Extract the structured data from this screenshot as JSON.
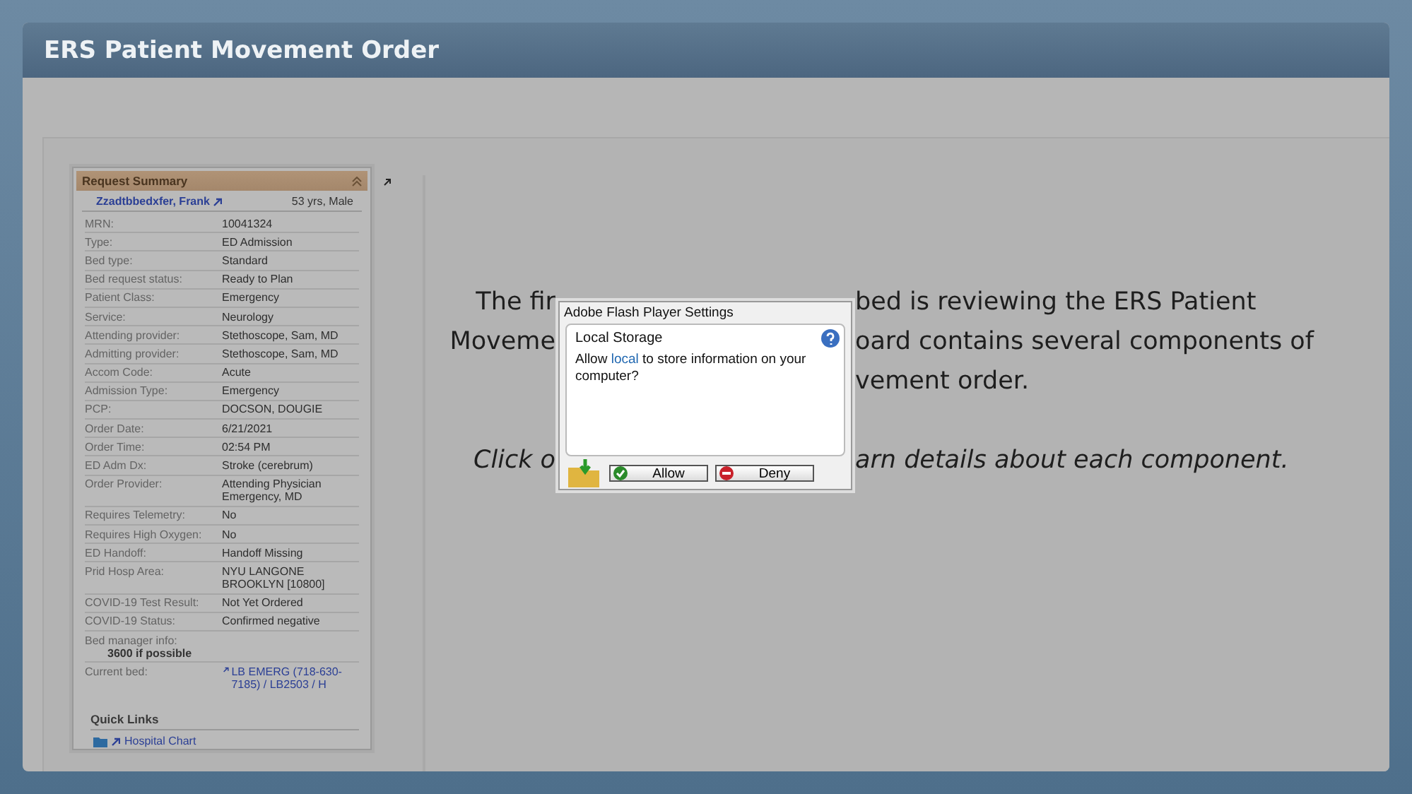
{
  "window": {
    "title": "ERS Patient Movement Order"
  },
  "summary": {
    "title": "Request Summary",
    "patient": "Zzadtbbedxfer, Frank",
    "age_sex": "53 yrs, Male",
    "rows": [
      {
        "kind": "plain",
        "label": "MRN:",
        "value": "10041324"
      },
      {
        "kind": "plain",
        "label": "Type:",
        "value": "ED Admission"
      },
      {
        "kind": "plain",
        "label": "Bed type:",
        "value": "Standard"
      },
      {
        "kind": "plain",
        "label": "Bed request status:",
        "value": "Ready to Plan"
      },
      {
        "kind": "plain",
        "label": "Patient Class:",
        "value": "Emergency"
      },
      {
        "kind": "plain",
        "label": "Service:",
        "value": "Neurology"
      },
      {
        "kind": "plain",
        "label": "Attending provider:",
        "value": "Stethoscope, Sam, MD"
      },
      {
        "kind": "plain",
        "label": "Admitting provider:",
        "value": "Stethoscope, Sam, MD"
      },
      {
        "kind": "plain",
        "label": "Accom Code:",
        "value": "Acute"
      },
      {
        "kind": "plain",
        "label": "Admission Type:",
        "value": "Emergency"
      },
      {
        "kind": "plain",
        "label": "PCP:",
        "value": "DOCSON, DOUGIE"
      },
      {
        "kind": "plain",
        "label": "Order Date:",
        "value": "6/21/2021"
      },
      {
        "kind": "plain",
        "label": "Order Time:",
        "value": "02:54 PM"
      },
      {
        "kind": "plain",
        "label": "ED Adm Dx:",
        "value": "Stroke (cerebrum)"
      },
      {
        "kind": "plain",
        "label": "Order Provider:",
        "value": "Attending Physician Emergency, MD"
      },
      {
        "kind": "plain",
        "label": "Requires Telemetry:",
        "value": "No"
      },
      {
        "kind": "plain",
        "label": "Requires High Oxygen:",
        "value": "No"
      },
      {
        "kind": "plain",
        "label": "ED Handoff:",
        "value": "Handoff Missing"
      },
      {
        "kind": "plain",
        "label": "Prid Hosp Area:",
        "value": "NYU LANGONE BROOKLYN [10800]"
      },
      {
        "kind": "plain",
        "label": "COVID-19 Test Result:",
        "value": "Not Yet Ordered"
      },
      {
        "kind": "plain",
        "label": "COVID-19 Status:",
        "value": "Confirmed negative"
      },
      {
        "kind": "stacked",
        "label": "Bed manager info:",
        "value": "3600 if possible"
      },
      {
        "kind": "link",
        "label": "Current bed:",
        "value": "LB EMERG (718-630-7185) / LB2503 / H"
      }
    ],
    "quick_links_title": "Quick Links",
    "quick_links": [
      "Hospital Chart"
    ]
  },
  "intro": {
    "line_1_left": "The fir",
    "line_1_right": "bed is reviewing the ERS Patient",
    "line_2_left": "Moveme",
    "line_2_right": "oard contains several components of",
    "line_3_right": "vement order.",
    "line_4_left": "Click o",
    "line_4_right": "arn details about each component."
  },
  "dialog": {
    "title": "Adobe Flash Player Settings",
    "heading": "Local Storage",
    "message_before": "Allow",
    "message_link": "local",
    "message_after": "to store information on your computer?",
    "buttons": [
      "Allow",
      "Deny"
    ]
  }
}
